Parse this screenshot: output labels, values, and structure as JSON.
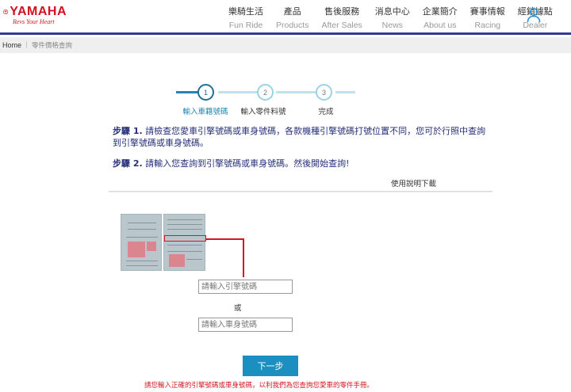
{
  "header": {
    "logo_text": "YAMAHA",
    "logo_tagline": "Revs Your Heart",
    "nav": [
      {
        "zh": "樂騎生活",
        "en": "Fun Ride"
      },
      {
        "zh": "產品",
        "en": "Products"
      },
      {
        "zh": "售後服務",
        "en": "After Sales"
      },
      {
        "zh": "消息中心",
        "en": "News"
      },
      {
        "zh": "企業簡介",
        "en": "About us"
      },
      {
        "zh": "賽事情報",
        "en": "Racing"
      },
      {
        "zh": "經銷據點",
        "en": "Dealer"
      }
    ],
    "user_icon": "user-icon"
  },
  "breadcrumb": {
    "home": "Home",
    "current": "零件價格查詢"
  },
  "steps": [
    {
      "number": "1",
      "label": "輸入車籍號碼"
    },
    {
      "number": "2",
      "label": "輸入零件料號"
    },
    {
      "number": "3",
      "label": "完成"
    }
  ],
  "instructions": {
    "step1_prefix": "步驟 1.",
    "step1_text": "請檢查您愛車引擎號碼或車身號碼，各款機種引擎號碼打號位置不同，您可於行照中查詢到引擎號碼或車身號碼。",
    "step2_prefix": "步驟 2.",
    "step2_text": "請輸入您查詢到引擎號碼或車身號碼。然後開始查詢!"
  },
  "download_link": "使用說明下載",
  "form": {
    "engine_placeholder": "請輸入引擎號碼",
    "or_text": "或",
    "body_placeholder": "請輸入車身號碼",
    "next_label": "下一步",
    "warning": "請您輸入正確的引擎號碼或車身號碼，以利我們為您查詢您愛車的零件手冊。"
  },
  "colors": {
    "brand_red": "#d5101f",
    "nav_border": "#2f3d93",
    "instruction_blue": "#26307a",
    "button_blue": "#1a8fc0",
    "step_active": "#1f86b5"
  }
}
